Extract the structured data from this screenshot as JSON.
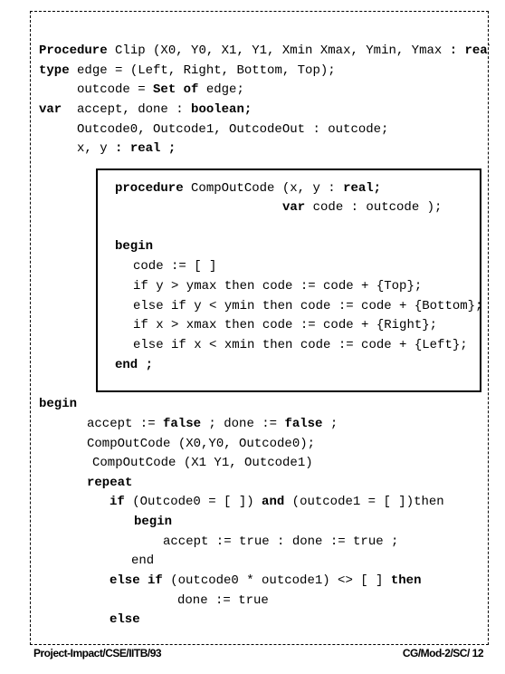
{
  "code_lines": [
    [
      [
        "Procedure",
        true
      ],
      [
        " Clip (X0, Y0, X1, Y1, Xmin Xmax, Ymin, Ymax ",
        false
      ],
      [
        ": real",
        true
      ]
    ],
    [
      [
        "type",
        true
      ],
      [
        " edge = (Left, Right, Bottom, Top);",
        false
      ]
    ],
    [
      [
        "outcode = ",
        false
      ],
      [
        "Set of",
        true
      ],
      [
        " edge;",
        false
      ]
    ],
    [
      [
        "var",
        true
      ],
      [
        "  accept, done : ",
        false
      ],
      [
        "boolean;",
        true
      ]
    ],
    [
      [
        "Outcode0, Outcode1, OutcodeOut : outcode;",
        false
      ]
    ],
    [
      [
        "x, y ",
        false
      ],
      [
        ": real ;",
        true
      ]
    ],
    [
      [
        "procedure",
        true
      ],
      [
        " CompOutCode (x, y : ",
        false
      ],
      [
        "real;",
        true
      ]
    ],
    [
      [
        "var",
        true
      ],
      [
        " code : outcode );",
        false
      ]
    ],
    [
      [
        "begin",
        true
      ]
    ],
    [
      [
        "code := [ ]",
        false
      ]
    ],
    [
      [
        "if y > ymax then code := code + {Top};",
        false
      ]
    ],
    [
      [
        "else if y < ymin then code := code + {Bottom};",
        false
      ]
    ],
    [
      [
        "if x > xmax then code := code + {Right};",
        false
      ]
    ],
    [
      [
        "else if x < xmin then code := code + {Left};",
        false
      ]
    ],
    [
      [
        "end ;",
        true
      ]
    ],
    [
      [
        "begin",
        true
      ]
    ],
    [
      [
        "accept := ",
        false
      ],
      [
        "false",
        true
      ],
      [
        " ; done := ",
        false
      ],
      [
        "false",
        true
      ],
      [
        " ;",
        false
      ]
    ],
    [
      [
        "CompOutCode (X0,Y0, Outcode0);",
        false
      ]
    ],
    [
      [
        "CompOutCode (X1 Y1, Outcode1)",
        false
      ]
    ],
    [
      [
        "repeat",
        true
      ]
    ],
    [
      [
        "if",
        true
      ],
      [
        " (Outcode0 = [ ]) ",
        false
      ],
      [
        "and",
        true
      ],
      [
        " (outcode1 = [ ])then",
        false
      ]
    ],
    [
      [
        "begin",
        true
      ]
    ],
    [
      [
        "accept := true : done := true ;",
        false
      ]
    ],
    [
      [
        "end",
        false
      ]
    ],
    [
      [
        "else if",
        true
      ],
      [
        " (outcode0 * outcode1) <> [ ] ",
        false
      ],
      [
        "then",
        true
      ]
    ],
    [
      [
        "done := true",
        false
      ]
    ],
    [
      [
        "else",
        true
      ]
    ]
  ],
  "footer": {
    "left": "Project-Impact/CSE/IITB/93",
    "right": "CG/Mod-2/SC/ 12"
  }
}
